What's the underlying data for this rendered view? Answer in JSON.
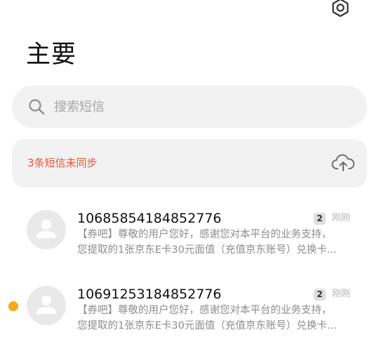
{
  "header": {
    "settings_icon": "settings-icon",
    "title": "主要"
  },
  "search": {
    "icon": "search-icon",
    "placeholder": "搜索短信"
  },
  "sync_notice": {
    "text": "3条短信未同步",
    "color": "#e8533c",
    "icon": "cloud-upload-icon"
  },
  "messages": [
    {
      "sender": "10685854184852776",
      "count": "2",
      "time": "刚刚",
      "unread": false,
      "line1": "【券吧】尊敬的用户您好，感谢您对本平台的业务支持，",
      "line2": "您提取的1张京东E卡30元面值（充值京东账号）兑换卡..."
    },
    {
      "sender": "10691253184852776",
      "count": "2",
      "time": "刚刚",
      "unread": true,
      "unread_color": "#f7a81b",
      "line1": "【券吧】尊敬的用户您好，感谢您对本平台的业务支持，",
      "line2": "您提取的1张京东E卡30元面值（充值京东账号）兑换卡..."
    }
  ]
}
